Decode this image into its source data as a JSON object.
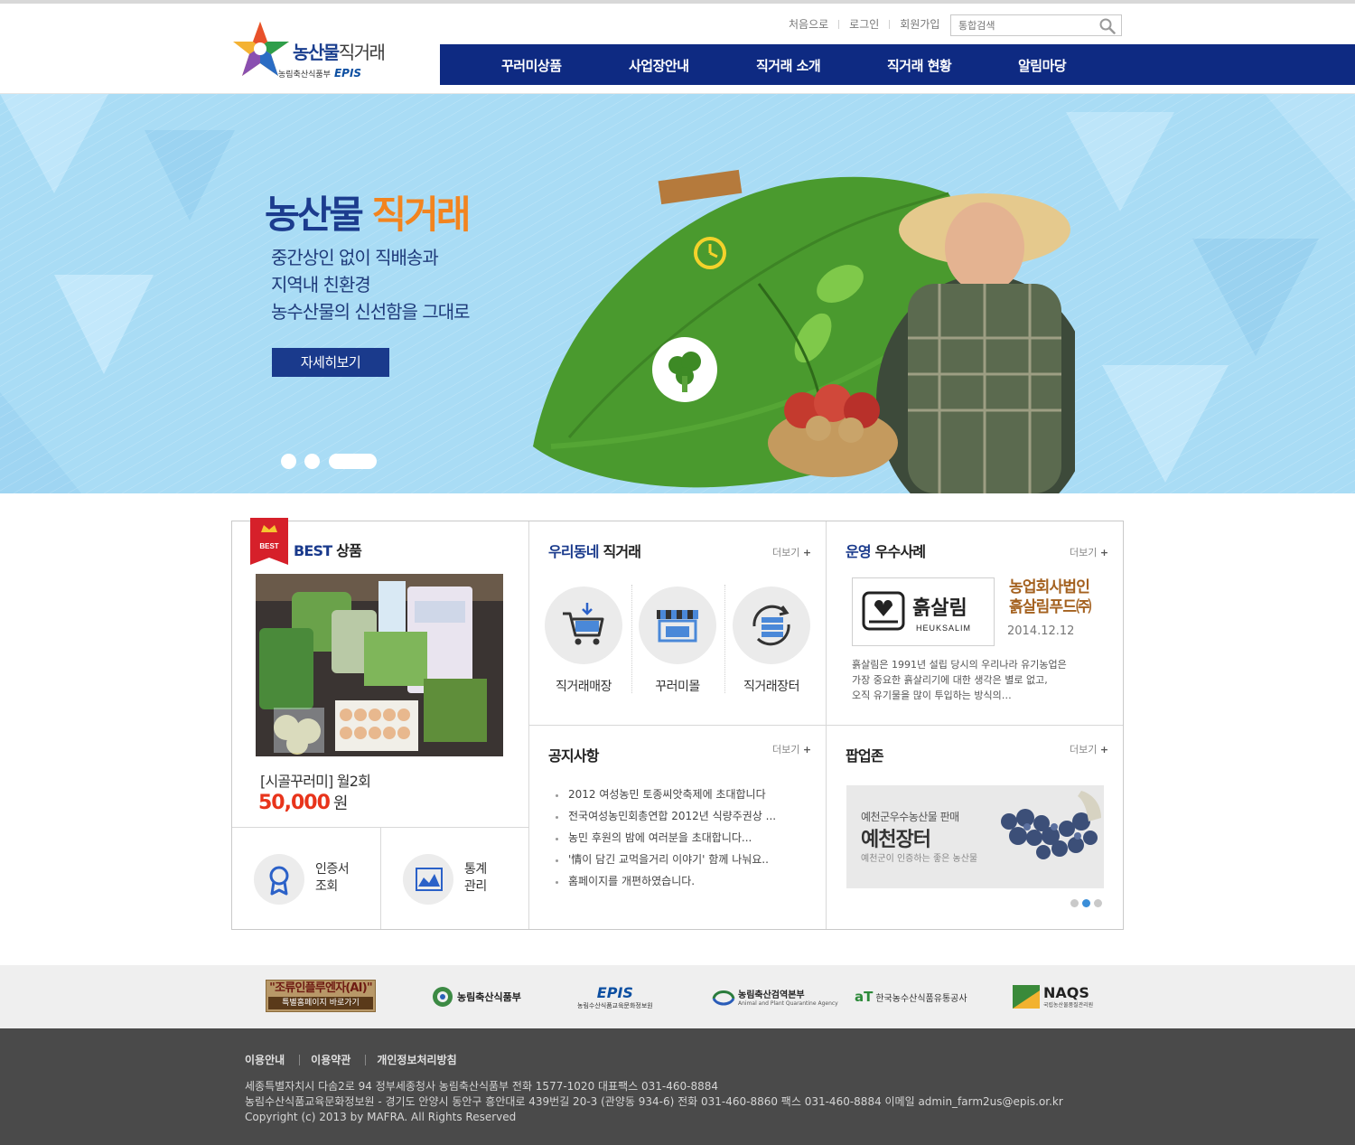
{
  "header": {
    "logo": {
      "title_bold": "농산물",
      "title_light": "직거래",
      "ministry": "농림축산식품부",
      "epis": "EPIS"
    },
    "util_links": [
      "처음으로",
      "로그인",
      "회원가입"
    ],
    "search_placeholder": "통합검색",
    "nav": [
      "꾸러미상품",
      "사업장안내",
      "직거래 소개",
      "직거래 현황",
      "알림마당"
    ]
  },
  "hero": {
    "title_main": "농산물 ",
    "title_accent": "직거래",
    "lines": [
      "중간상인 없이 직배송과",
      "지역내 친환경",
      "농수산물의 신선함을 그대로"
    ],
    "button": "자세히보기",
    "slide_count": 3,
    "active_slide": 3
  },
  "best": {
    "ribbon": "BEST",
    "title_accent": "BEST",
    "title_rest": " 상품",
    "product_name": "[시골꾸러미] 월2회",
    "price": "50,000",
    "unit": "원",
    "quick_links": [
      {
        "line1": "인증서",
        "line2": "조회",
        "icon": "ribbon-badge-icon"
      },
      {
        "line1": "통계",
        "line2": "관리",
        "icon": "chart-icon"
      }
    ]
  },
  "direct": {
    "title_accent": "우리동네",
    "title_rest": " 직거래",
    "more": "더보기",
    "services": [
      {
        "label": "직거래매장",
        "icon": "cart-icon"
      },
      {
        "label": "꾸러미몰",
        "icon": "store-icon"
      },
      {
        "label": "직거래장터",
        "icon": "exchange-icon"
      }
    ]
  },
  "case": {
    "title_accent": "운영",
    "title_rest": " 우수사례",
    "more": "더보기",
    "logo_text": "흙살림",
    "logo_sub": "HEUKSALIM",
    "name_line1": "농업회사법인",
    "name_line2": "흙살림푸드㈜",
    "date": "2014.12.12",
    "desc": [
      "흙살림은 1991년 설립 당시의 우리나라 유기농업은",
      "가장 중요한 흙살리기에 대한 생각은 별로 없고,",
      "오직 유기물을 많이 투입하는 방식의…"
    ]
  },
  "notice": {
    "title": "공지사항",
    "more": "더보기",
    "items": [
      "2012 여성농민 토종씨앗축제에 초대합니다",
      "전국여성농민회총연합 2012년 식량주권상 ...",
      "농민 후원의 밤에 여러분을 초대합니다...",
      "'情이 담긴 교먹을거리 이야기' 함께 나눠요..",
      "홈페이지를 개편하였습니다."
    ]
  },
  "popup": {
    "title": "팝업존",
    "more": "더보기",
    "line1": "예천군우수농산물 판매",
    "line2": "예천장터",
    "line3": "예천군이 인증하는 좋은 농산물",
    "slide_count": 3,
    "active_slide": 2
  },
  "partners": {
    "ai_line1": "\"조류인플루엔자(AI)\"",
    "ai_line2": "특별홈페이지 바로가기",
    "mafra": "농림축산식품부",
    "epis": "EPIS",
    "epis_sub": "농림수산식품교육문화정보원",
    "qia": "농림축산검역본부",
    "qia_sub": "Animal and Plant Quarantine Agency",
    "at": "aT",
    "at_sub": "한국농수산식품유통공사",
    "naqs": "NAQS",
    "naqs_sub": "국립농산물품질관리원"
  },
  "footer": {
    "links": [
      "이용안내",
      "이용약관",
      "개인정보처리방침"
    ],
    "address": [
      "세종특별자치시 다솜2로 94 정부세종청사 농림축산식품부    전화 1577-1020  대표팩스 031-460-8884",
      "농림수산식품교육문화정보원 - 경기도 안양시 동안구 흥안대로 439번길 20-3 (관양동 934-6)    전화 031-460-8860  팩스 031-460-8884  이메일 admin_farm2us@epis.or.kr",
      "Copyright (c) 2013 by MAFRA. All Rights Reserved"
    ]
  },
  "colors": {
    "navy": "#0e2a82",
    "accent_orange": "#f2841f",
    "price_red": "#e8341b",
    "hero_sky": "#a9dcf5"
  }
}
